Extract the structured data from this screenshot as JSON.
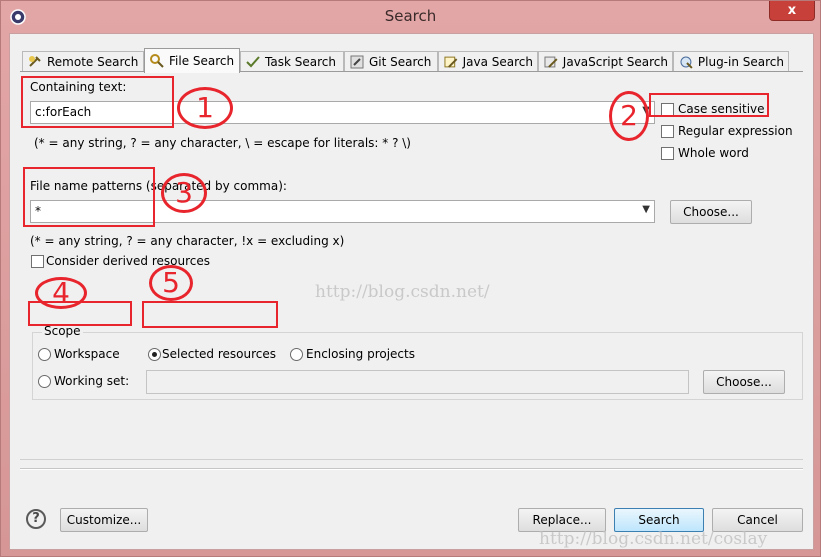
{
  "window": {
    "title": "Search",
    "close_glyph": "x"
  },
  "tabs": [
    {
      "label": "Remote Search",
      "icon": "remote-search-icon",
      "active": false
    },
    {
      "label": "File Search",
      "icon": "file-search-icon",
      "active": true
    },
    {
      "label": "Task Search",
      "icon": "task-search-icon",
      "active": false
    },
    {
      "label": "Git Search",
      "icon": "git-search-icon",
      "active": false
    },
    {
      "label": "Java Search",
      "icon": "java-search-icon",
      "active": false
    },
    {
      "label": "JavaScript Search",
      "icon": "javascript-search-icon",
      "active": false
    },
    {
      "label": "Plug-in Search",
      "icon": "plugin-search-icon",
      "active": false
    }
  ],
  "containing": {
    "label": "Containing text:",
    "value": "c:forEach",
    "hint": "(* = any string, ? = any character, \\ = escape for literals: * ? \\)"
  },
  "options": {
    "case_sensitive": {
      "label": "Case sensitive",
      "checked": false
    },
    "regex": {
      "label": "Regular expression",
      "checked": false
    },
    "whole_word": {
      "label": "Whole word",
      "checked": false
    }
  },
  "patterns": {
    "label": "File name patterns (separated by comma):",
    "value": "*",
    "choose_label": "Choose...",
    "hint": "(* = any string, ? = any character, !x = excluding x)"
  },
  "derived": {
    "label": "Consider derived resources",
    "checked": false
  },
  "scope": {
    "title": "Scope",
    "workspace_label": "Workspace",
    "selected_label": "Selected resources",
    "enclosing_label": "Enclosing projects",
    "working_set_label": "Working set:",
    "working_set_value": "",
    "choose_label": "Choose...",
    "selected": "selected"
  },
  "footer": {
    "help_glyph": "?",
    "customize_label": "Customize...",
    "replace_label": "Replace...",
    "search_label": "Search",
    "cancel_label": "Cancel"
  },
  "annotations": [
    "1",
    "2",
    "3",
    "4",
    "5"
  ],
  "watermarks": {
    "center": "http://blog.csdn.net/",
    "bottom": "http://blog.csdn.net/coslay"
  },
  "colors": {
    "annotation": "#e8242c",
    "titlebar": "#d99a9a",
    "default_button": "#bee6fd"
  }
}
